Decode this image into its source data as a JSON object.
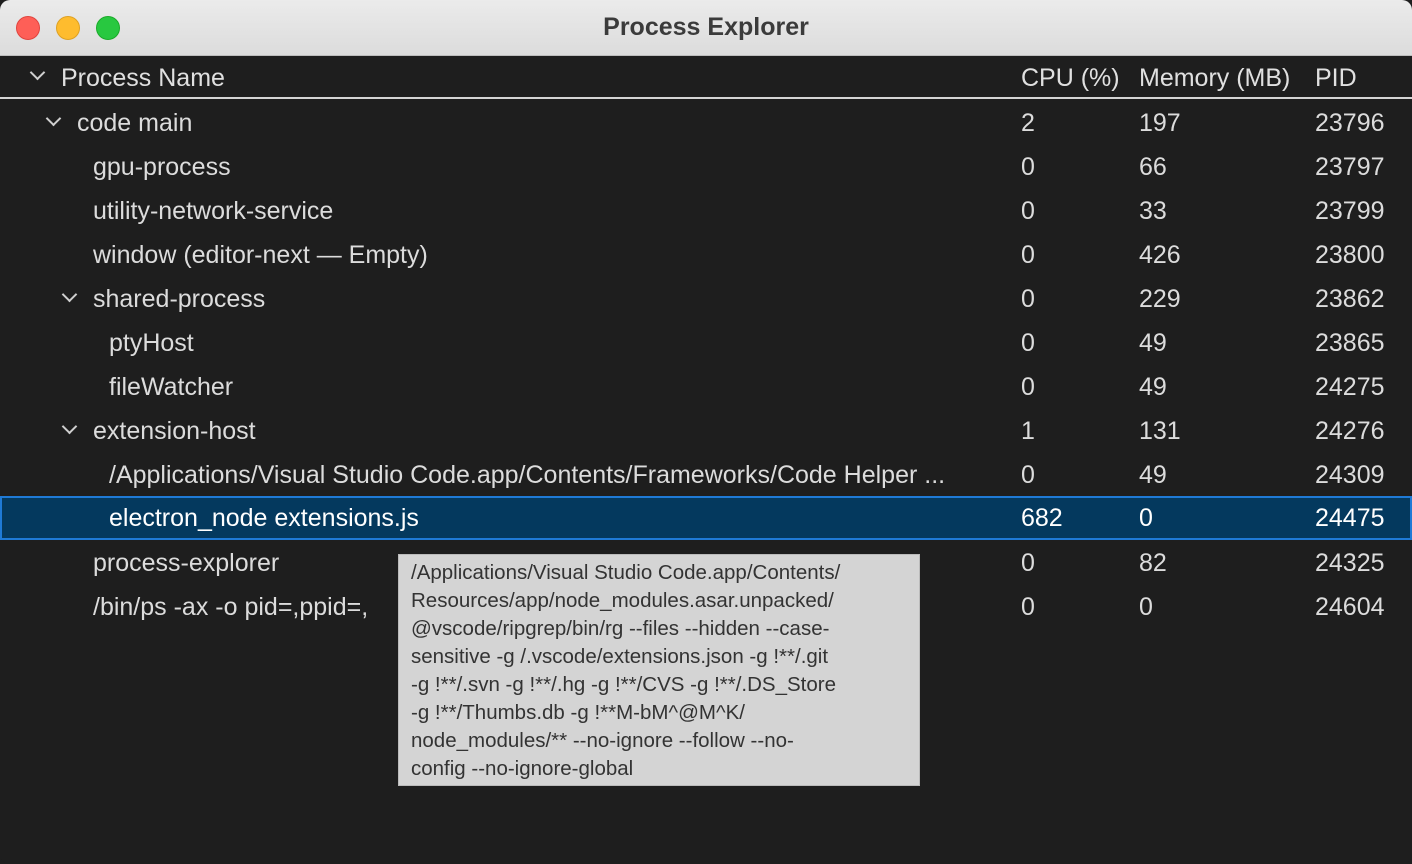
{
  "window": {
    "title": "Process Explorer"
  },
  "columns": {
    "name": "Process Name",
    "cpu": "CPU (%)",
    "memory": "Memory (MB)",
    "pid": "PID"
  },
  "rows": [
    {
      "name": "code main",
      "cpu": "2",
      "memory": "197",
      "pid": "23796",
      "expanded": true,
      "level": 0
    },
    {
      "name": "gpu-process",
      "cpu": "0",
      "memory": "66",
      "pid": "23797",
      "level": 1
    },
    {
      "name": "utility-network-service",
      "cpu": "0",
      "memory": "33",
      "pid": "23799",
      "level": 1
    },
    {
      "name": "window (editor-next — Empty)",
      "cpu": "0",
      "memory": "426",
      "pid": "23800",
      "level": 1
    },
    {
      "name": "shared-process",
      "cpu": "0",
      "memory": "229",
      "pid": "23862",
      "expanded": true,
      "level": 1
    },
    {
      "name": "ptyHost",
      "cpu": "0",
      "memory": "49",
      "pid": "23865",
      "level": 2
    },
    {
      "name": "fileWatcher",
      "cpu": "0",
      "memory": "49",
      "pid": "24275",
      "level": 2
    },
    {
      "name": "extension-host",
      "cpu": "1",
      "memory": "131",
      "pid": "24276",
      "expanded": true,
      "level": 1
    },
    {
      "name": "/Applications/Visual Studio Code.app/Contents/Frameworks/Code Helper ...",
      "cpu": "0",
      "memory": "49",
      "pid": "24309",
      "level": 2
    },
    {
      "name": "electron_node extensions.js",
      "cpu": "682",
      "memory": "0",
      "pid": "24475",
      "level": 2,
      "selected": true
    },
    {
      "name": "process-explorer",
      "cpu": "0",
      "memory": "82",
      "pid": "24325",
      "level": 1
    },
    {
      "name": "/bin/ps -ax -o pid=,ppid=,",
      "cpu": "0",
      "memory": "0",
      "pid": "24604",
      "level": 1
    }
  ],
  "tooltip": {
    "lines": [
      "/Applications/Visual Studio Code.app/Contents/",
      "Resources/app/node_modules.asar.unpacked/",
      "@vscode/ripgrep/bin/rg --files --hidden --case-",
      "sensitive -g /.vscode/extensions.json -g !**/.git",
      "-g !**/.svn -g !**/.hg -g !**/CVS -g !**/.DS_Store",
      "-g !**/Thumbs.db -g !**M-bM^@M^K/",
      "node_modules/** --no-ignore --follow --no-",
      "config --no-ignore-global"
    ]
  },
  "colors": {
    "background": "#1e1e1e",
    "selected_row": "#04395e",
    "selected_border": "#1f7ad6",
    "tooltip_bg": "#d4d4d4"
  }
}
